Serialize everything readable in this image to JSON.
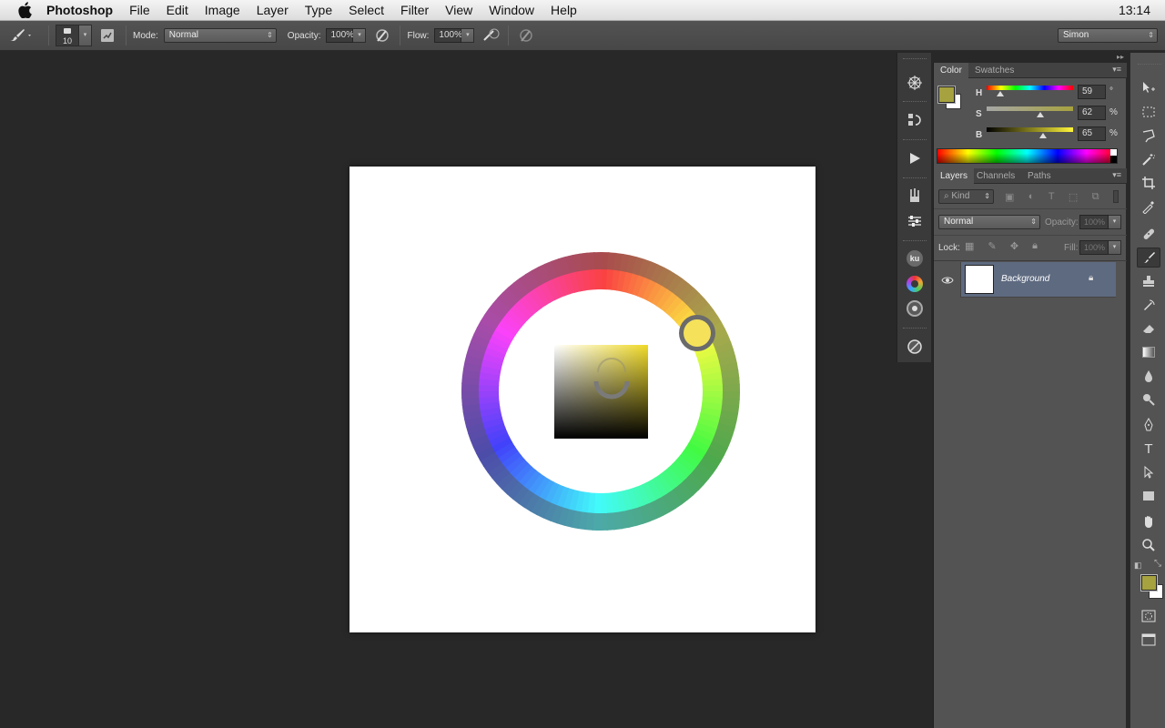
{
  "menubar": {
    "app": "Photoshop",
    "items": [
      "File",
      "Edit",
      "Image",
      "Layer",
      "Type",
      "Select",
      "Filter",
      "View",
      "Window",
      "Help"
    ],
    "clock": "13:14"
  },
  "options": {
    "brush_size": "10",
    "mode_label": "Mode:",
    "mode_value": "Normal",
    "opacity_label": "Opacity:",
    "opacity_value": "100%",
    "flow_label": "Flow:",
    "flow_value": "100%",
    "workspace": "Simon"
  },
  "color_panel": {
    "tabs": [
      "Color",
      "Swatches"
    ],
    "foreground": "#a6a23f",
    "sliders": [
      {
        "label": "H",
        "value": "59",
        "unit": "°",
        "position": 0.16
      },
      {
        "label": "S",
        "value": "62",
        "unit": "%",
        "position": 0.62
      },
      {
        "label": "B",
        "value": "65",
        "unit": "%",
        "position": 0.65
      }
    ]
  },
  "layers_panel": {
    "tabs": [
      "Layers",
      "Channels",
      "Paths"
    ],
    "filter_kind": "Kind",
    "blend_mode": "Normal",
    "opacity_label": "Opacity:",
    "opacity_value": "100%",
    "lock_label": "Lock:",
    "fill_label": "Fill:",
    "fill_value": "100%",
    "layers": [
      {
        "name": "Background",
        "visible": true,
        "locked": true
      }
    ]
  },
  "color_wheel": {
    "selected_hex": "#f5e25a",
    "square_hue_hex": "#f0da28"
  },
  "strip_labels": {
    "ku": "ku"
  },
  "toolbar": {
    "foreground": "#a6a23f",
    "background": "#ffffff",
    "selected_tool": "brush"
  }
}
